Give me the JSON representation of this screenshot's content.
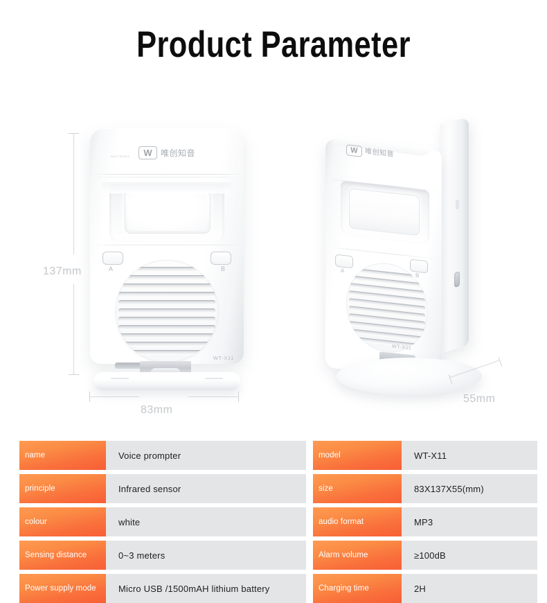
{
  "page": {
    "title": "Product Parameter",
    "background_color": "#ffffff"
  },
  "product": {
    "brand_mark": "W",
    "brand_cn": "唯创知音",
    "brand_sub": "WAYTRONIC",
    "model_label": "WT-X11",
    "button_a": "A",
    "button_b": "B",
    "views": [
      {
        "name": "front-view",
        "caption_height": "137mm",
        "caption_width": "83mm"
      },
      {
        "name": "angled-view",
        "caption_depth": "55mm"
      }
    ]
  },
  "dimensions": {
    "height": "137mm",
    "width": "83mm",
    "depth": "55mm",
    "line_color": "#d6d9dc",
    "label_color": "#c3c6ca"
  },
  "specs": {
    "key_color": "#ffffff",
    "key_bg_start": "#ff9a52",
    "key_bg_end": "#f85f36",
    "value_bg": "#e4e5e7",
    "value_color": "#212121",
    "left": [
      {
        "key": "name",
        "value": "Voice prompter"
      },
      {
        "key": "principle",
        "value": "Infrared sensor"
      },
      {
        "key": "colour",
        "value": "white"
      },
      {
        "key": "Sensing distance",
        "value": "0~3 meters"
      },
      {
        "key": "Power supply mode",
        "value": "Micro USB /1500mAH lithium battery"
      }
    ],
    "right": [
      {
        "key": "model",
        "value": "WT-X11"
      },
      {
        "key": "size",
        "value": "83X137X55(mm)"
      },
      {
        "key": "audio format",
        "value": "MP3"
      },
      {
        "key": "Alarm volume",
        "value": "≥100dB"
      },
      {
        "key": "Charging time",
        "value": "2H"
      }
    ]
  }
}
